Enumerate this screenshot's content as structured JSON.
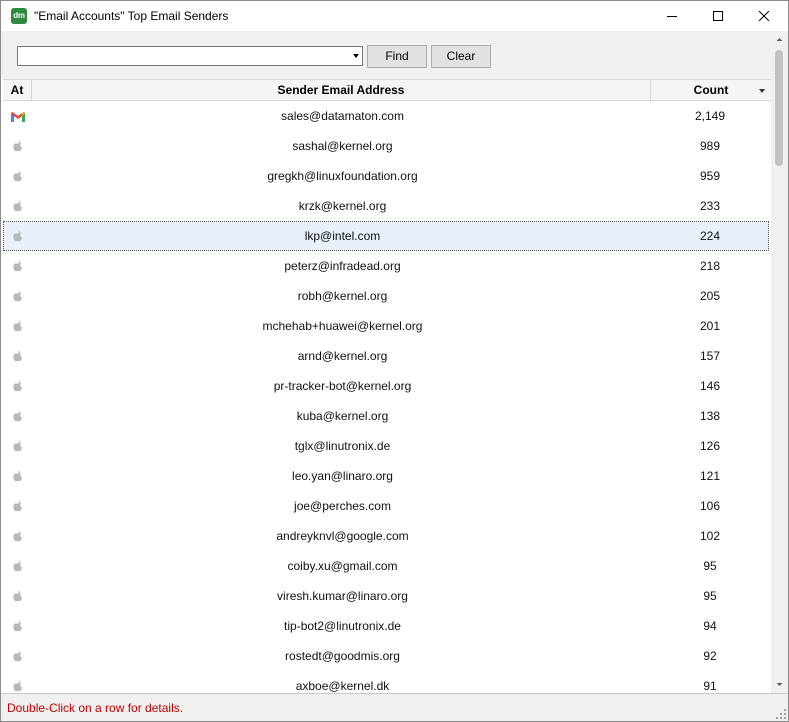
{
  "window": {
    "app_icon_label": "dm",
    "title": "\"Email Accounts\" Top Email Senders"
  },
  "toolbar": {
    "search_value": "",
    "find_label": "Find",
    "clear_label": "Clear"
  },
  "table": {
    "columns": {
      "at": "At",
      "email": "Sender Email Address",
      "count": "Count"
    },
    "sort": {
      "column": "count",
      "direction": "descending"
    },
    "selected_index": 4,
    "rows": [
      {
        "icon": "gmail-icon",
        "email": "sales@datamaton.com",
        "count": "2,149"
      },
      {
        "icon": "apple-icon",
        "email": "sashal@kernel.org",
        "count": "989"
      },
      {
        "icon": "apple-icon",
        "email": "gregkh@linuxfoundation.org",
        "count": "959"
      },
      {
        "icon": "apple-icon",
        "email": "krzk@kernel.org",
        "count": "233"
      },
      {
        "icon": "apple-icon",
        "email": "lkp@intel.com",
        "count": "224"
      },
      {
        "icon": "apple-icon",
        "email": "peterz@infradead.org",
        "count": "218"
      },
      {
        "icon": "apple-icon",
        "email": "robh@kernel.org",
        "count": "205"
      },
      {
        "icon": "apple-icon",
        "email": "mchehab+huawei@kernel.org",
        "count": "201"
      },
      {
        "icon": "apple-icon",
        "email": "arnd@kernel.org",
        "count": "157"
      },
      {
        "icon": "apple-icon",
        "email": "pr-tracker-bot@kernel.org",
        "count": "146"
      },
      {
        "icon": "apple-icon",
        "email": "kuba@kernel.org",
        "count": "138"
      },
      {
        "icon": "apple-icon",
        "email": "tglx@linutronix.de",
        "count": "126"
      },
      {
        "icon": "apple-icon",
        "email": "leo.yan@linaro.org",
        "count": "121"
      },
      {
        "icon": "apple-icon",
        "email": "joe@perches.com",
        "count": "106"
      },
      {
        "icon": "apple-icon",
        "email": "andreyknvl@google.com",
        "count": "102"
      },
      {
        "icon": "apple-icon",
        "email": "coiby.xu@gmail.com",
        "count": "95"
      },
      {
        "icon": "apple-icon",
        "email": "viresh.kumar@linaro.org",
        "count": "95"
      },
      {
        "icon": "apple-icon",
        "email": "tip-bot2@linutronix.de",
        "count": "94"
      },
      {
        "icon": "apple-icon",
        "email": "rostedt@goodmis.org",
        "count": "92"
      },
      {
        "icon": "apple-icon",
        "email": "axboe@kernel.dk",
        "count": "91"
      }
    ]
  },
  "status": {
    "message": "Double-Click on a row for details."
  },
  "colors": {
    "status_text": "#c00000",
    "selected_row": "#e8f0fb",
    "app_icon": "#2e8b3e"
  }
}
